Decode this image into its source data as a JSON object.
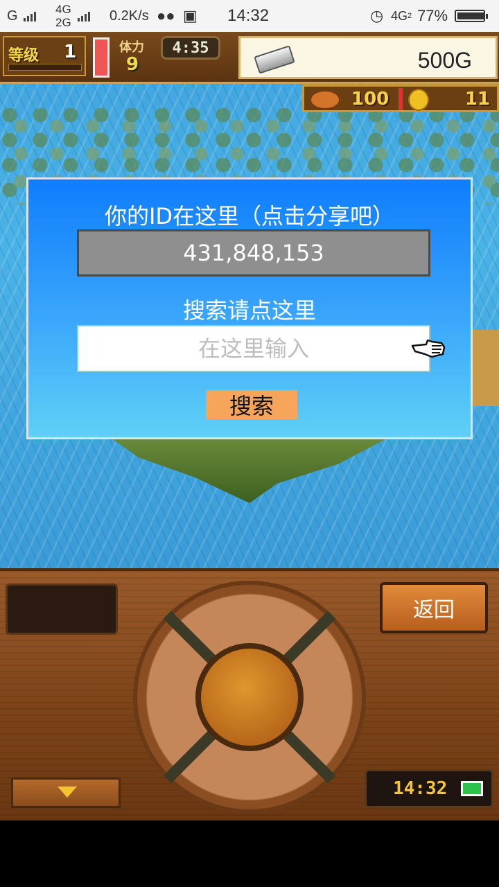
{
  "status_bar": {
    "carrier1": "G",
    "net1": "4G",
    "net2": "2G",
    "speed": "0.2K/s",
    "time": "14:32",
    "net_right": "4G",
    "net_right_sub": "2",
    "battery": "77%",
    "battery_level": 0.77
  },
  "hud": {
    "level_label": "等级",
    "level_value": "1",
    "stamina_label": "体力",
    "stamina_value": "9",
    "timer": "4:35",
    "gold": "500G",
    "food": "100",
    "coins": "11"
  },
  "dialog": {
    "title": "你的ID在这里（点击分享吧）",
    "id_value": "431,848,153",
    "search_label": "搜索请点这里",
    "input_placeholder": "在这里输入",
    "search_button": "搜索"
  },
  "panel": {
    "back_button": "返回",
    "clock": "14:32"
  },
  "colors": {
    "dialog_top": "#0f7dfd",
    "dialog_bottom": "#5fd0f6",
    "search_button": "#f6a55a",
    "id_box": "#8f8f8f"
  }
}
